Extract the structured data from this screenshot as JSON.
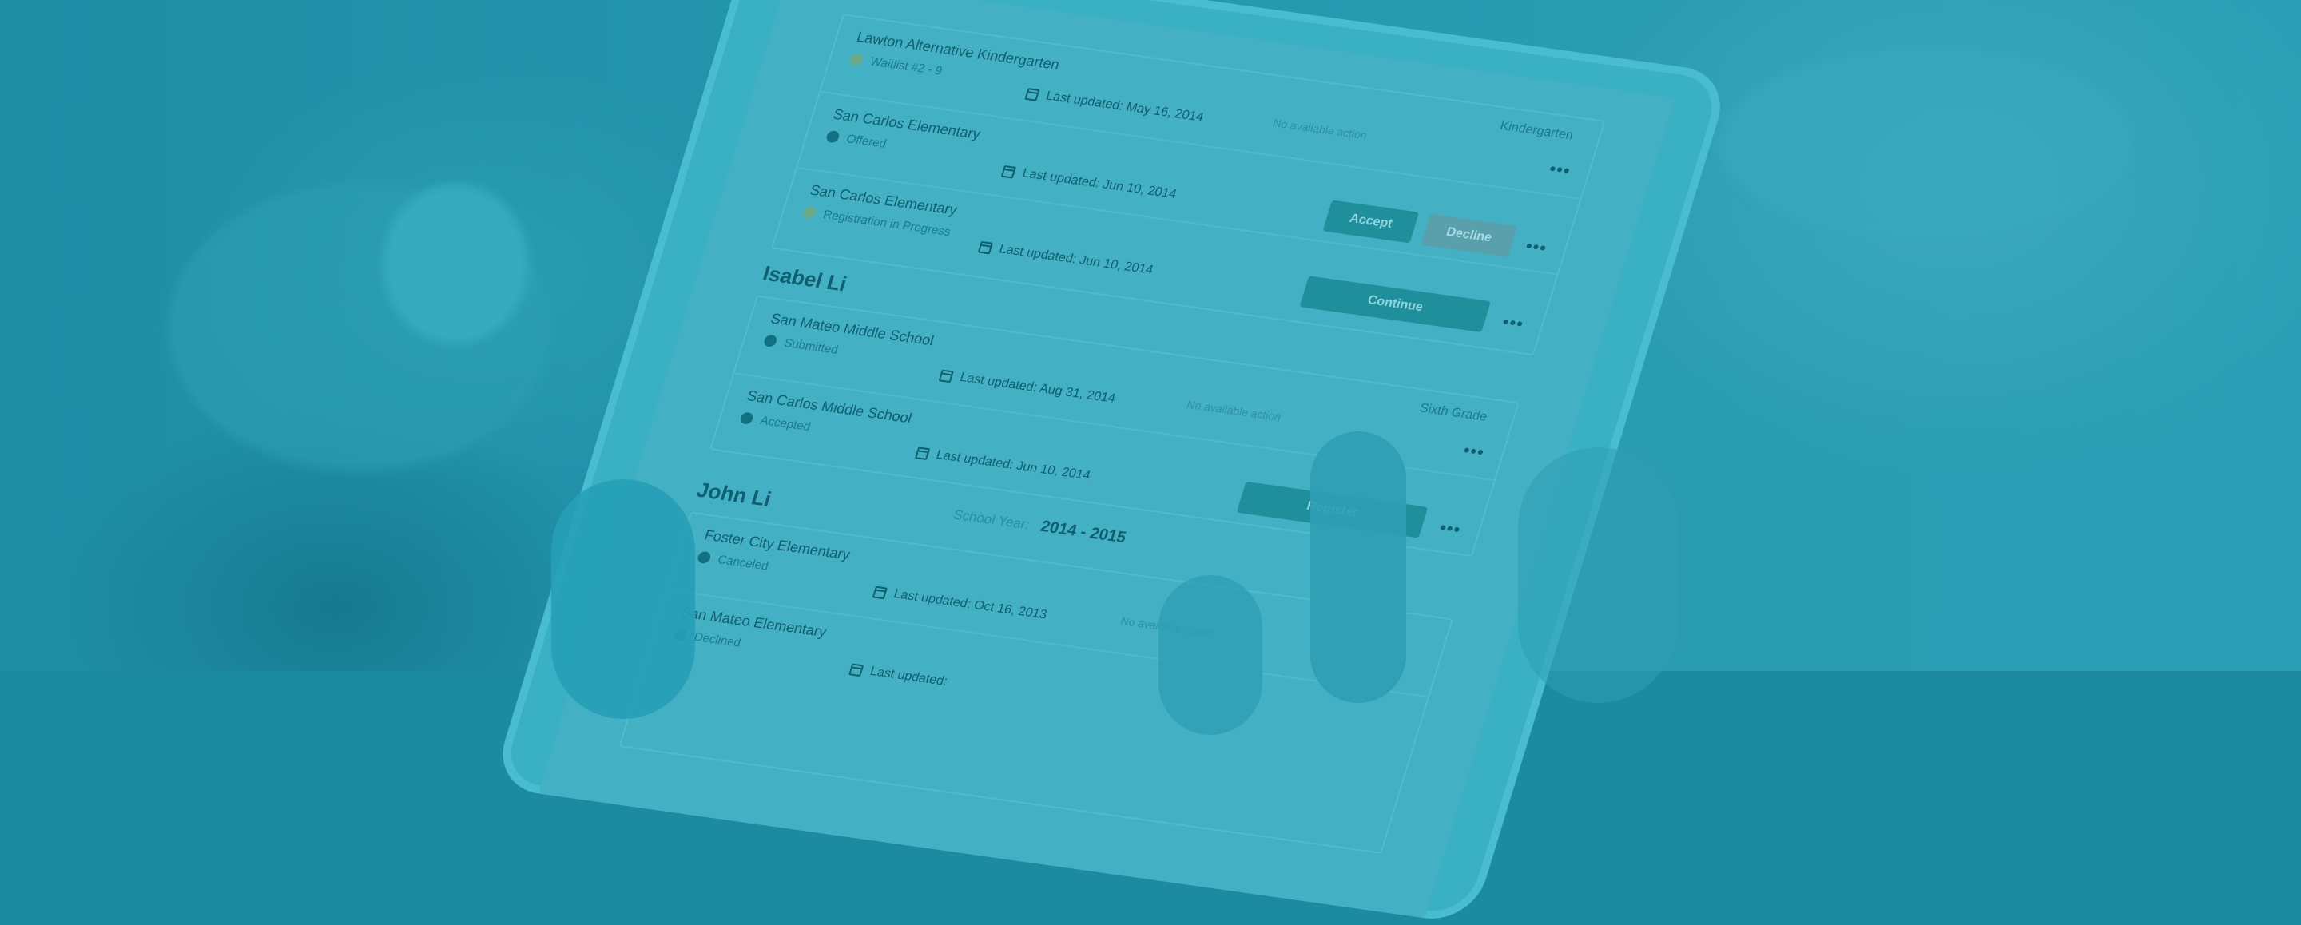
{
  "screen": {
    "top_group": {
      "rows": [
        {
          "school": "Lawton Alternative Kindergarten",
          "status": "Waitlist #2 - 9",
          "status_color": "yellow",
          "updated": "Last updated: May 16, 2014",
          "action_text": "No available action",
          "grade": "Kindergarten"
        },
        {
          "school": "San Carlos Elementary",
          "status": "Offered",
          "status_color": "teal",
          "updated": "Last updated: Jun 10, 2014",
          "accept": "Accept",
          "decline": "Decline"
        },
        {
          "school": "San Carlos Elementary",
          "status": "Registration in Progress",
          "status_color": "yellow",
          "updated": "Last updated: Jun 10, 2014",
          "continue": "Continue"
        }
      ]
    },
    "isabel": {
      "name": "Isabel Li",
      "rows": [
        {
          "school": "San Mateo Middle School",
          "status": "Submitted",
          "updated": "Last updated: Aug 31, 2014",
          "action_text": "No available action",
          "grade": "Sixth Grade"
        },
        {
          "school": "San Carlos Middle School",
          "status": "Accepted",
          "updated": "Last updated: Jun 10, 2014",
          "register": "Register"
        }
      ]
    },
    "school_year": {
      "label": "School Year:",
      "value": "2014 - 2015"
    },
    "john": {
      "name": "John Li",
      "rows": [
        {
          "school": "Foster City Elementary",
          "status": "Canceled",
          "updated": "Last updated: Oct 16, 2013",
          "action_text": "No available action"
        },
        {
          "school": "San Mateo Elementary",
          "status": "Declined",
          "updated": "Last updated:"
        }
      ]
    },
    "more_glyph": "•••"
  },
  "colors": {
    "overlay": "#1c8aa0",
    "text_dark": "#0f5f70",
    "button_teal": "#1f8f9c"
  }
}
